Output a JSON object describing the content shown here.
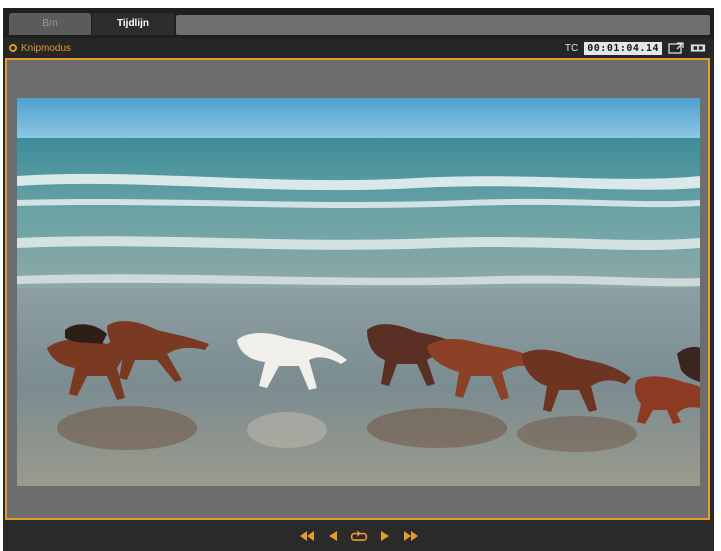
{
  "tabs": [
    {
      "label": "Brn"
    },
    {
      "label": "Tijdlijn"
    }
  ],
  "toolbar": {
    "mode_label": "Knipmodus",
    "timecode_label": "TC",
    "timecode_value": "00:01:04.14"
  },
  "icons": {
    "mode": "circle-mode-icon",
    "detach": "detach-window-icon",
    "aspect": "aspect-ratio-icon"
  },
  "transport": [
    "skip-to-start-icon",
    "step-back-icon",
    "loop-icon",
    "play-icon",
    "skip-to-end-icon"
  ],
  "colors": {
    "accent": "#e79a2d",
    "preview_border": "#e79a2d",
    "background": "#2a2a2a"
  }
}
